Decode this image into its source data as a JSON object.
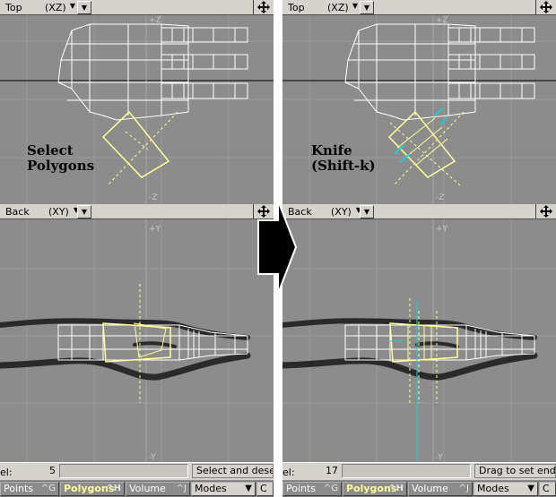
{
  "panels": [
    {
      "id": "left",
      "top_view": {
        "name": "Top",
        "axes": "(XZ)",
        "axis_top": "+Z",
        "axis_bottom": "-Z"
      },
      "bottom_view": {
        "name": "Back",
        "axes": "(XY)",
        "axis_top": "+Y",
        "axis_bottom": "-Y"
      },
      "label_line1": "Select",
      "label_line2": "Polygons",
      "status": {
        "prefix": "el:",
        "value": "5",
        "message": "Select and desele"
      },
      "modes": {
        "points": "Points",
        "points_key": "^G",
        "polygons": "Polygons",
        "polygons_key": "^H",
        "volume": "Volume",
        "volume_key": "^J",
        "modes": "Modes",
        "extra": "C"
      }
    },
    {
      "id": "right",
      "top_view": {
        "name": "Top",
        "axes": "(XZ)",
        "axis_top": "+Z",
        "axis_bottom": "-Z"
      },
      "bottom_view": {
        "name": "Back",
        "axes": "(XY)",
        "axis_top": "+Y",
        "axis_bottom": "-Y"
      },
      "label_line1": "Knife",
      "label_line2": "(Shift-k)",
      "status": {
        "prefix": "el:",
        "value": "17",
        "message": "Drag to set endpo"
      },
      "modes": {
        "points": "Points",
        "points_key": "^G",
        "polygons": "Polygons",
        "polygons_key": "^H",
        "volume": "Volume",
        "volume_key": "^J",
        "modes": "Modes",
        "extra": "C"
      }
    }
  ],
  "icons": {
    "dropdown": "triangle-down",
    "move": "four-way-arrow",
    "transition": "right-arrow"
  },
  "colors": {
    "viewport_bg": "#8c8c8c",
    "grid": "#9a9a9a",
    "wire": "#ffffff",
    "selected": "#ffff99",
    "knife": "#22cccc",
    "header": "#d6d3ce"
  }
}
